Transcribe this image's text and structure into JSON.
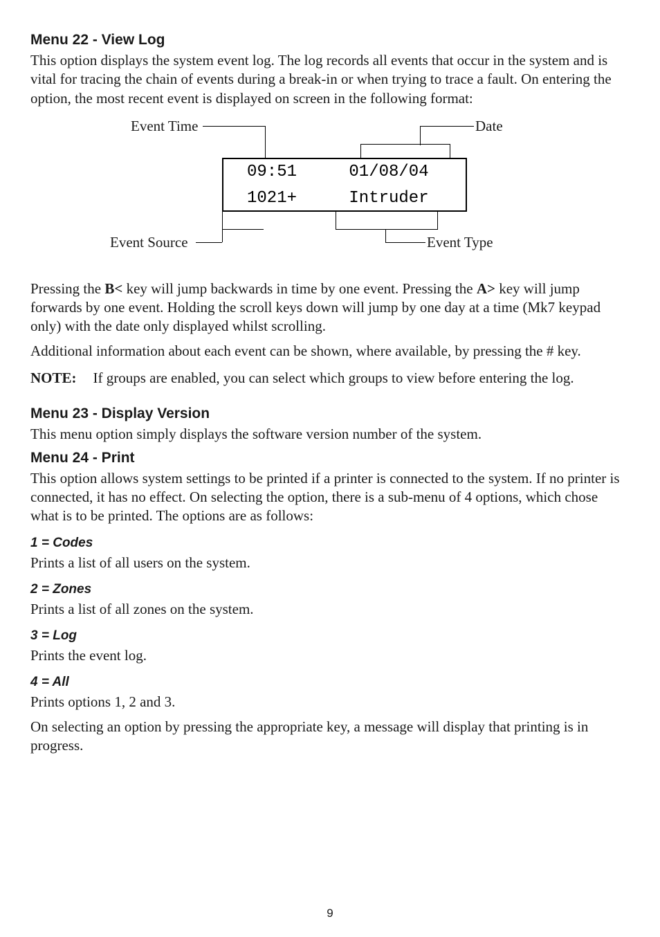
{
  "menu22": {
    "title": "Menu 22 - View Log",
    "p1": "This option displays the system event log. The log records all events that occur in the system and is vital for tracing the chain of events during a break-in or when trying to trace a fault. On entering the option, the most recent event is displayed on screen in the following format:",
    "p2_a": "Pressing the ",
    "p2_b": "B<",
    "p2_c": " key will jump backwards in time by one event. Pressing the ",
    "p2_d": "A>",
    "p2_e": " key will jump forwards by one event.  Holding the scroll keys down will jump by one day at a time (Mk7 keypad only) with the date only displayed whilst scrolling.",
    "p3": "Additional information about each event can be shown, where available, by pressing the # key.",
    "note_label": "NOTE:",
    "note_text": "If groups are enabled, you can select which groups to view before entering the log."
  },
  "diagram": {
    "event_time": "Event Time",
    "date": "Date",
    "event_source": "Event Source",
    "event_type": "Event Type",
    "disp_time": "09:51",
    "disp_date": "01/08/04",
    "disp_src": "1021+",
    "disp_type": "Intruder"
  },
  "menu23": {
    "title": "Menu 23 - Display Version",
    "p1": "This menu option simply displays the software version number of the system."
  },
  "menu24": {
    "title": "Menu 24 - Print",
    "p1": "This option allows system settings to be printed if a printer is connected to the system. If no printer is connected, it has no effect. On selecting the option, there is a sub-menu of 4 options, which chose what is to be printed. The options are as follows:",
    "opt1_h": "1 = Codes",
    "opt1_p": "Prints a list of all users on the system.",
    "opt2_h": "2 = Zones",
    "opt2_p": "Prints a list of all zones on the system.",
    "opt3_h": "3 = Log",
    "opt3_p": "Prints the event log.",
    "opt4_h": "4 = All",
    "opt4_p": "Prints options 1, 2 and 3.",
    "p2": "On selecting an option by pressing the appropriate key, a message will display that printing is in progress."
  },
  "page_number": "9"
}
